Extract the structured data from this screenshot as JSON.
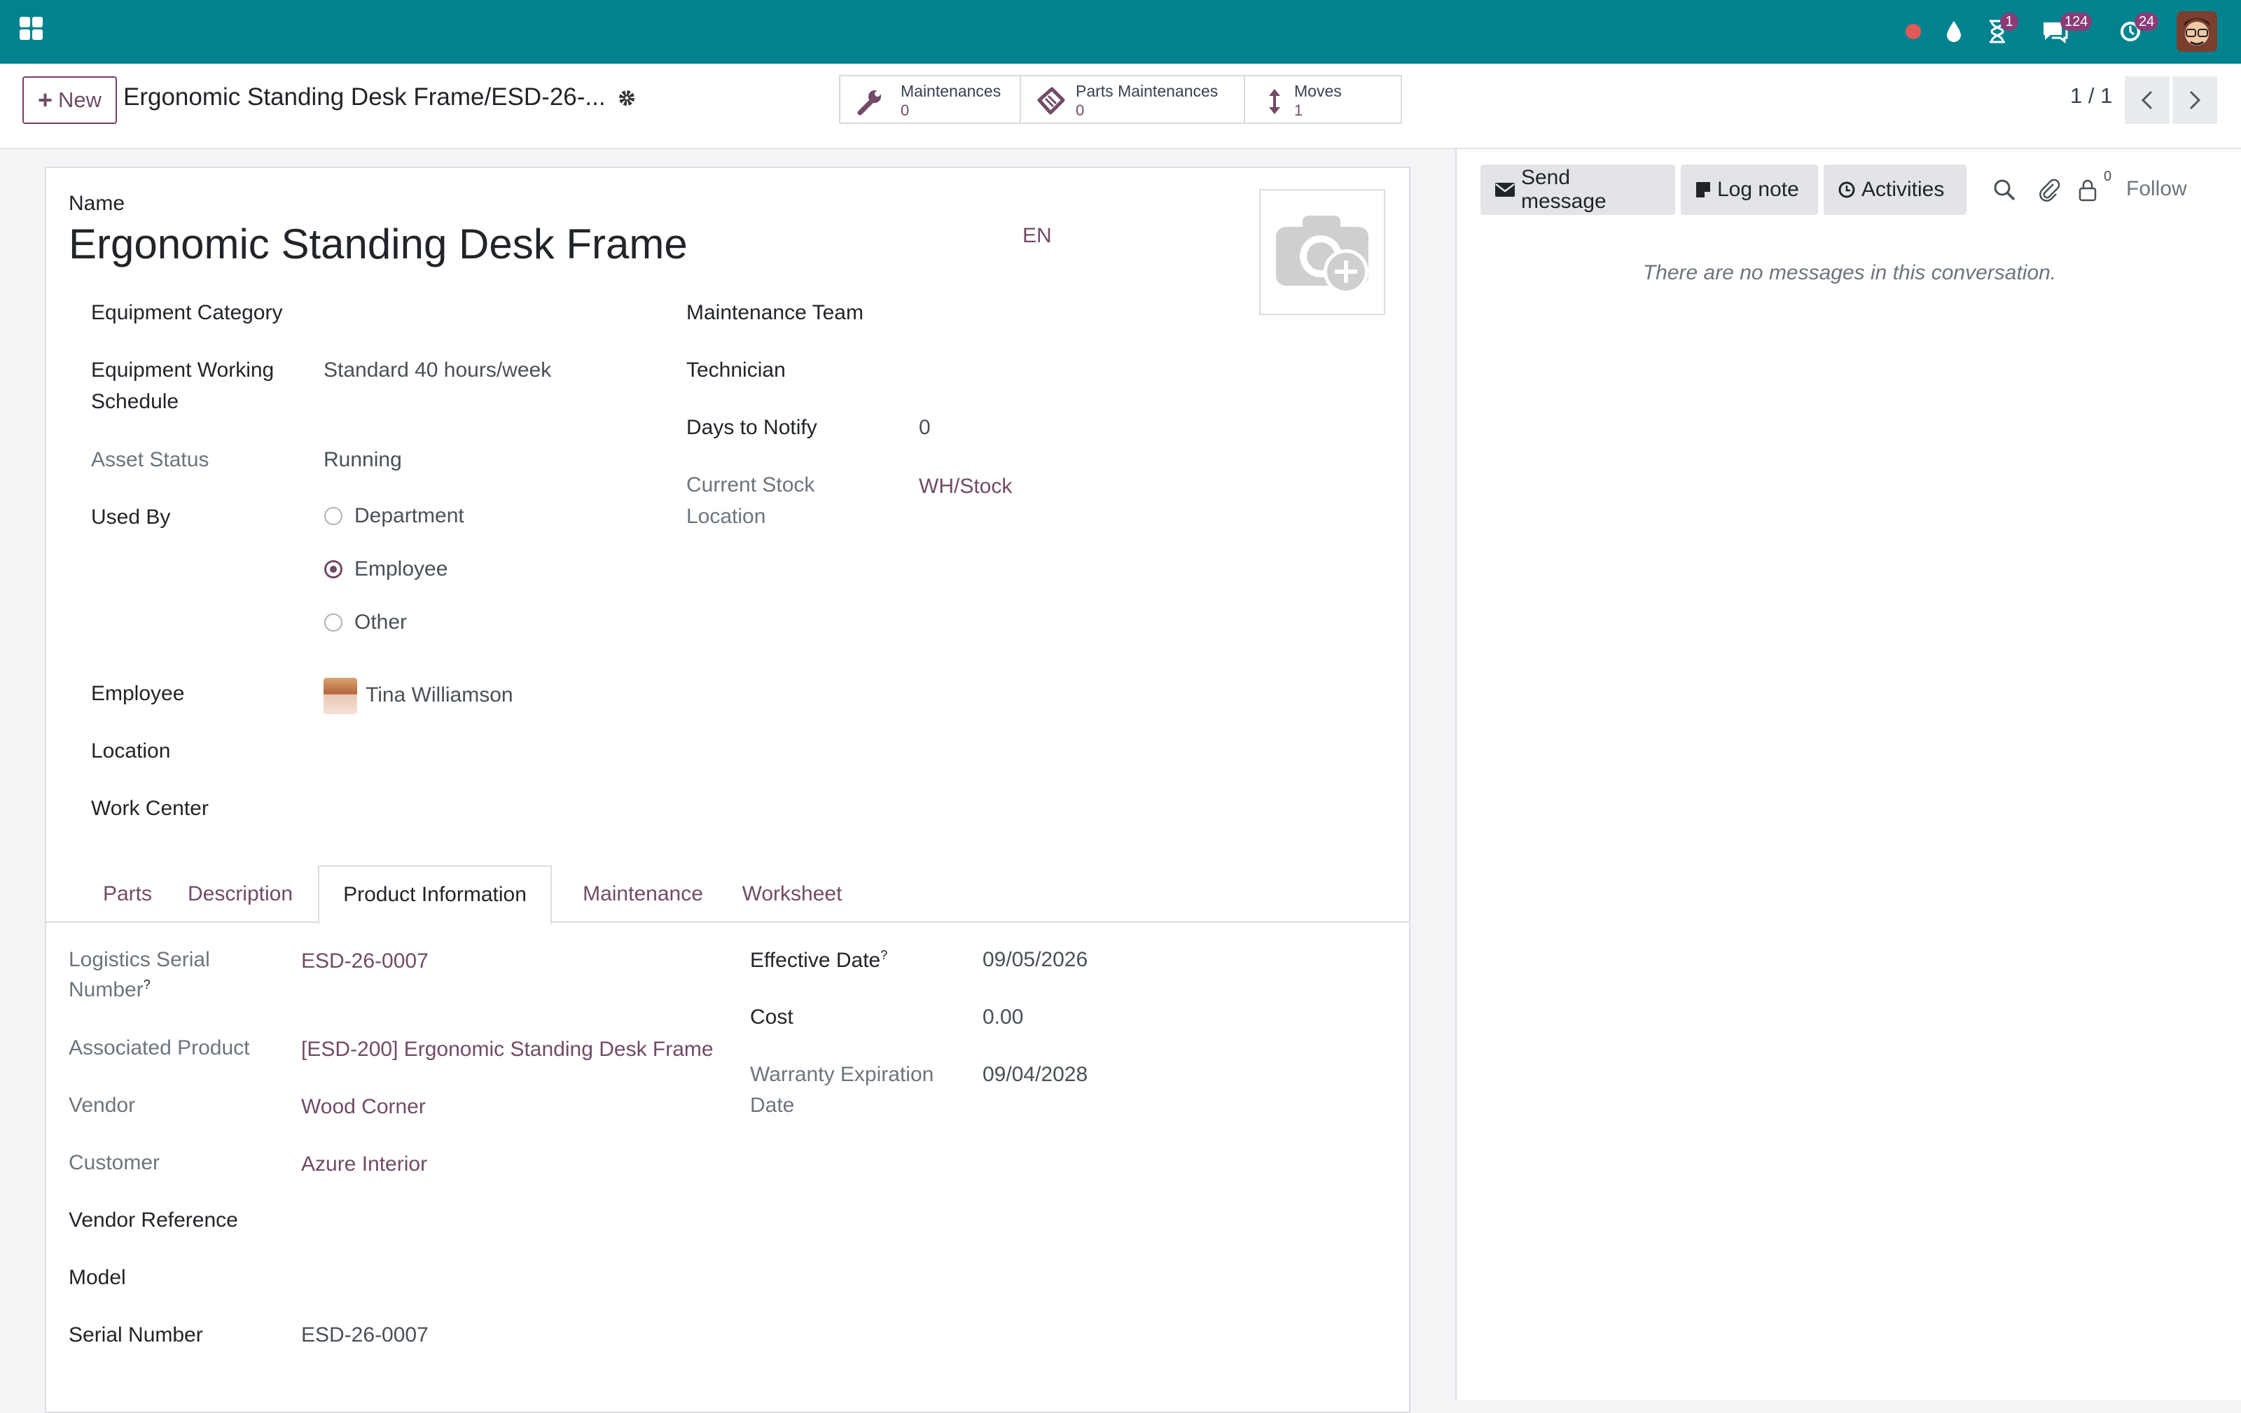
{
  "navbar": {
    "badges": {
      "activity": "1",
      "messages": "124",
      "timers": "24"
    },
    "colors": {
      "bar": "#00838f",
      "badge": "#8a3c77",
      "record": "#e05a5a"
    }
  },
  "control_panel": {
    "new_label": "New",
    "breadcrumb": "Ergonomic Standing Desk Frame/ESD-26-...",
    "smart_buttons": [
      {
        "label": "Maintenances",
        "value": "0",
        "icon": "wrench-icon"
      },
      {
        "label": "Parts Maintenances",
        "value": "0",
        "icon": "ticket-icon"
      },
      {
        "label": "Moves",
        "value": "1",
        "icon": "up-down-arrow-icon"
      }
    ],
    "pager": "1 / 1"
  },
  "form": {
    "name_label": "Name",
    "name": "Ergonomic Standing Desk Frame",
    "lang": "EN",
    "left_fields": {
      "equipment_category": "Equipment Category",
      "working_schedule_label_1": "Equipment Working",
      "working_schedule_label_2": "Schedule",
      "working_schedule": "Standard 40 hours/week",
      "asset_status_label": "Asset Status",
      "asset_status": "Running",
      "used_by_label": "Used By",
      "used_by_options": [
        "Department",
        "Employee",
        "Other"
      ],
      "used_by_selected": "Employee",
      "employee_label": "Employee",
      "employee": "Tina Williamson",
      "location_label": "Location",
      "work_center_label": "Work Center"
    },
    "right_fields": {
      "maintenance_team_label": "Maintenance Team",
      "technician_label": "Technician",
      "days_to_notify_label": "Days to Notify",
      "days_to_notify": "0",
      "stock_location_label_1": "Current Stock",
      "stock_location_label_2": "Location",
      "stock_location": "WH/Stock"
    }
  },
  "tabs": [
    "Parts",
    "Description",
    "Product Information",
    "Maintenance",
    "Worksheet"
  ],
  "active_tab": "Product Information",
  "product_info": {
    "lsn_label_1": "Logistics Serial",
    "lsn_label_2": "Number",
    "lsn": "ESD-26-0007",
    "associated_product_label": "Associated Product",
    "associated_product": "[ESD-200] Ergonomic Standing Desk Frame",
    "vendor_label": "Vendor",
    "vendor": "Wood Corner",
    "customer_label": "Customer",
    "customer": "Azure Interior",
    "vendor_reference_label": "Vendor Reference",
    "model_label": "Model",
    "serial_number_label": "Serial Number",
    "serial_number": "ESD-26-0007",
    "effective_date_label": "Effective Date",
    "effective_date": "09/05/2026",
    "cost_label": "Cost",
    "cost": "0.00",
    "warranty_label_1": "Warranty Expiration",
    "warranty_label_2": "Date",
    "warranty": "09/04/2028",
    "help_mark": "?"
  },
  "chatter": {
    "send_message": "Send message",
    "log_note": "Log note",
    "activities": "Activities",
    "followers_count": "0",
    "follow": "Follow",
    "empty": "There are no messages in this conversation."
  }
}
